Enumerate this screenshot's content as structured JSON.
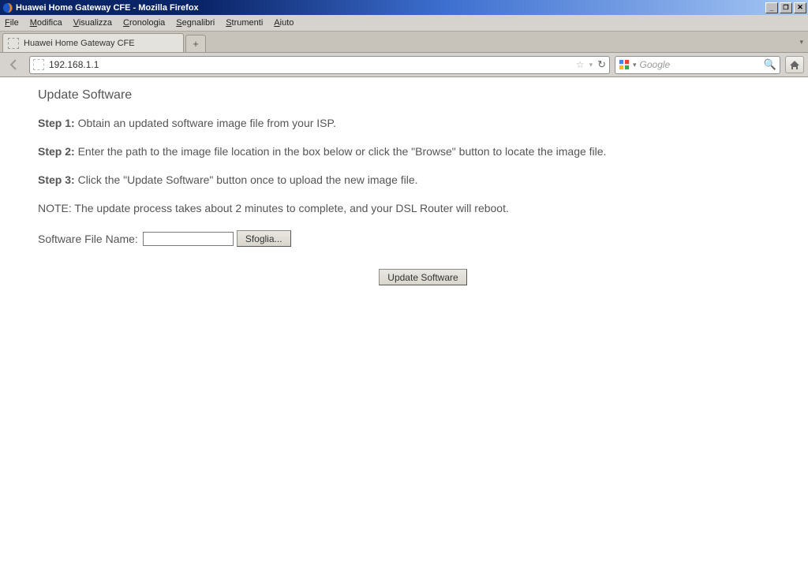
{
  "window": {
    "title": "Huawei Home Gateway CFE - Mozilla Firefox"
  },
  "menu": {
    "items": [
      "File",
      "Modifica",
      "Visualizza",
      "Cronologia",
      "Segnalibri",
      "Strumenti",
      "Aiuto"
    ]
  },
  "tab": {
    "title": "Huawei Home Gateway CFE",
    "newtab": "+"
  },
  "address": {
    "url": "192.168.1.1"
  },
  "search": {
    "placeholder": "Google"
  },
  "page": {
    "heading": "Update Software",
    "step1_label": "Step 1:",
    "step1_text": " Obtain an updated software image file from your ISP.",
    "step2_label": "Step 2:",
    "step2_text": " Enter the path to the image file location in the box below or click the \"Browse\" button to locate the image file.",
    "step3_label": "Step 3:",
    "step3_text": " Click the \"Update Software\" button once to upload the new image file.",
    "note": "NOTE: The update process takes about 2 minutes to complete, and your DSL Router will reboot.",
    "file_label": "Software File Name:",
    "browse_button": "Sfoglia...",
    "update_button": "Update Software"
  }
}
